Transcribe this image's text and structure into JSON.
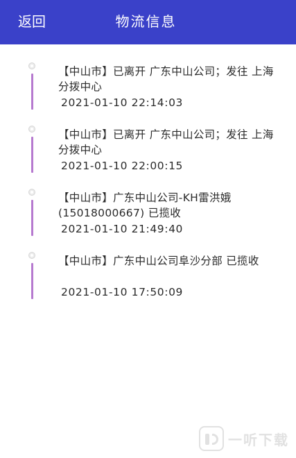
{
  "header": {
    "back_label": "返回",
    "title": "物流信息"
  },
  "colors": {
    "header_bg": "#3a41c9",
    "timeline_line": "#b679cf"
  },
  "timeline": [
    {
      "description": "【中山市】已离开 广东中山公司；发往 上海分拨中心",
      "time": "2021-01-10 22:14:03"
    },
    {
      "description": "【中山市】已离开 广东中山公司；发往 上海分拨中心",
      "time": "2021-01-10 22:00:15"
    },
    {
      "description": "【中山市】广东中山公司-KH雷洪娥(15018000667) 已揽收",
      "time": "2021-01-10 21:49:40"
    },
    {
      "description": "【中山市】广东中山公司阜沙分部 已揽收",
      "time": "2021-01-10 17:50:09"
    }
  ],
  "watermark": {
    "text": "一听下载",
    "icon": "app-logo-icon"
  }
}
